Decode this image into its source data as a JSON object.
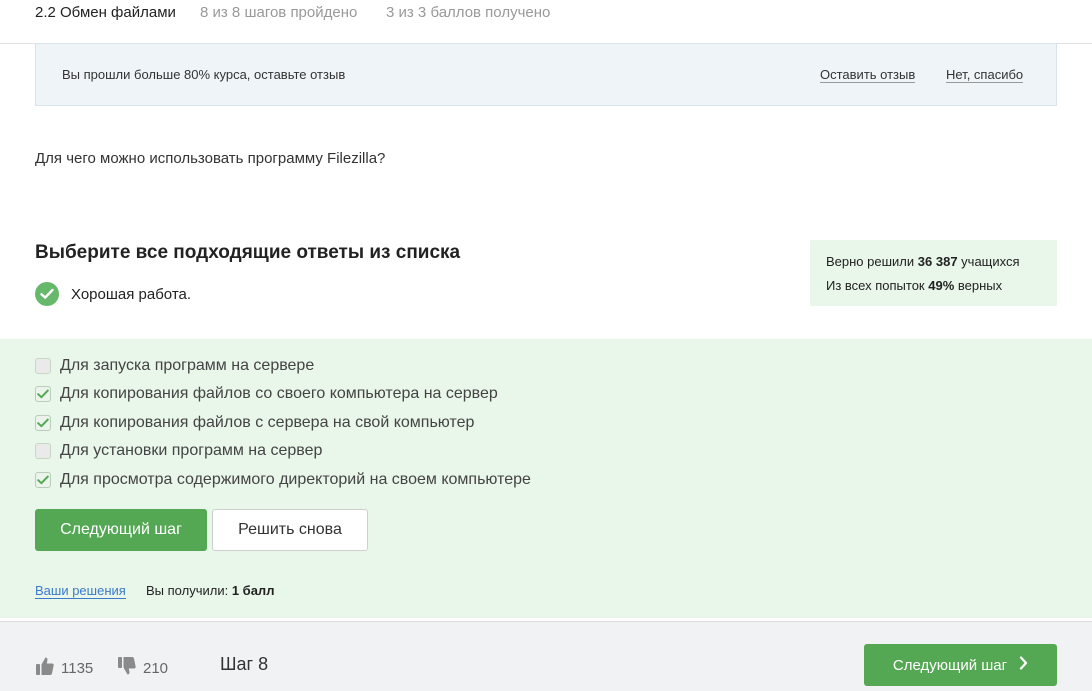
{
  "header": {
    "lesson": "2.2 Обмен файлами",
    "steps_progress": "8 из 8 шагов пройдено",
    "score_progress": "3 из 3 баллов  получено"
  },
  "banner": {
    "text": "Вы прошли больше 80% курса, оставьте отзыв",
    "leave_review": "Оставить отзыв",
    "no_thanks": "Нет, спасибо"
  },
  "question": "Для чего можно использовать программу Filezilla?",
  "task": {
    "title": "Выберите все подходящие ответы из списка",
    "feedback": "Хорошая работа."
  },
  "stats": {
    "solved_prefix": "Верно решили",
    "solved_count": "36 387",
    "solved_suffix": "учащихся",
    "attempts_prefix": "Из всех попыток",
    "attempts_percent": "49%",
    "attempts_suffix": "верных"
  },
  "options": [
    {
      "label": "Для запуска программ на сервере",
      "checked": false
    },
    {
      "label": "Для копирования файлов со своего компьютера на сервер",
      "checked": true
    },
    {
      "label": "Для копирования файлов с сервера на свой компьютер",
      "checked": true
    },
    {
      "label": "Для установки программ на сервер",
      "checked": false
    },
    {
      "label": "Для просмотра содержимого директорий на своем компьютере",
      "checked": true
    }
  ],
  "actions": {
    "next_step": "Следующий шаг",
    "retry": "Решить снова",
    "your_solutions": "Ваши решения",
    "received_label": "Вы получили:",
    "received_value": "1 балл"
  },
  "footer": {
    "likes": "1135",
    "dislikes": "210",
    "step": "Шаг 8",
    "next_step": "Следующий шаг"
  },
  "colors": {
    "accent_green": "#54a854",
    "success_bg": "#e9f6ea",
    "check_green": "#66b86a",
    "link_blue": "#3b7ac9"
  }
}
